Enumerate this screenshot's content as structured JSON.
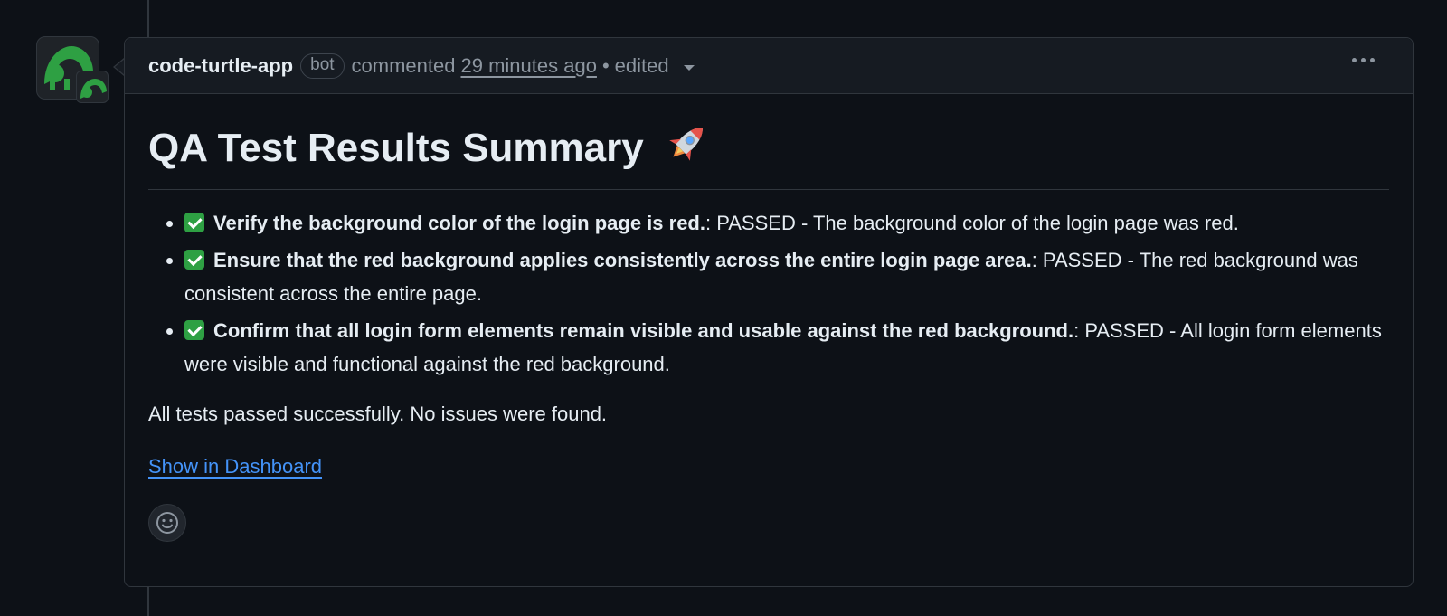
{
  "comment": {
    "author": "code-turtle-app",
    "bot_label": "bot",
    "action": "commented",
    "time": "29 minutes ago",
    "separator": "•",
    "edited": "edited"
  },
  "body": {
    "title": "QA Test Results Summary",
    "items": [
      {
        "bold": "Verify the background color of the login page is red.",
        "text": ": PASSED - The background color of the login page was red."
      },
      {
        "bold": "Ensure that the red background applies consistently across the entire login page area.",
        "text": ": PASSED - The red background was consistent across the entire page."
      },
      {
        "bold": "Confirm that all login form elements remain visible and usable against the red background.",
        "text": ": PASSED - All login form elements were visible and functional against the red background."
      }
    ],
    "summary": "All tests passed successfully. No issues were found.",
    "link": "Show in Dashboard"
  },
  "icons": {
    "avatar": "turtle-avatar-icon",
    "title_emoji": "rocket-icon",
    "item_marker": "check-mark-icon",
    "menu": "kebab-menu-icon",
    "reaction": "smiley-icon"
  },
  "colors": {
    "background": "#0d1117",
    "header": "#161b22",
    "border": "#30363d",
    "link": "#4493f8",
    "check": "#2ea043",
    "avatar_green": "#2ea043"
  }
}
